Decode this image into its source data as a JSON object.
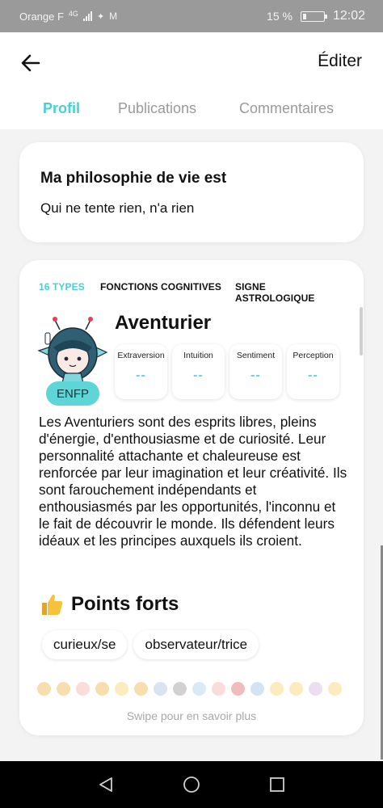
{
  "status": {
    "carrier": "Orange F",
    "network": "4G",
    "battery_pct": "15 %",
    "time": "12:02"
  },
  "header": {
    "back_icon": "arrow-left-icon",
    "edit_label": "Éditer"
  },
  "tabs": [
    {
      "label": "Profil",
      "active": true
    },
    {
      "label": "Publications",
      "active": false
    },
    {
      "label": "Commentaires",
      "active": false
    }
  ],
  "philosophy": {
    "title": "Ma philosophie de vie est",
    "text": "Qui ne tente rien, n'a rien"
  },
  "personality": {
    "subtabs": [
      {
        "label": "16 TYPES",
        "active": true
      },
      {
        "label": "FONCTIONS COGNITIVES",
        "active": false
      },
      {
        "label": "SIGNE ASTROLOGIQUE",
        "active": false
      }
    ],
    "type_name": "Aventurier",
    "code": "ENFP",
    "dimensions": [
      {
        "label": "Extraversion",
        "value": "--"
      },
      {
        "label": "Intuition",
        "value": "--"
      },
      {
        "label": "Sentiment",
        "value": "--"
      },
      {
        "label": "Perception",
        "value": "--"
      }
    ],
    "description": "Les Aventuriers sont des esprits libres, pleins d'énergie, d'enthousiasme et de curiosité. Leur personnalité attachante et chaleureuse est renforcée par leur imagination et leur créativité. Ils sont farouchement indépendants et enthousiasmés par les opportunités, l'inconnu et le fait de découvrir le monde. Ils défendent leurs idéaux et les principes auxquels ils croient.",
    "strengths_title": "Points forts",
    "strengths_icon": "thumbs-up-icon",
    "strengths": [
      "curieux/se",
      "observateur/trice"
    ],
    "swipe_hint": "Swipe pour en savoir plus"
  },
  "colors": {
    "accent": "#45d1d6",
    "badge": "#5ed6d8"
  }
}
